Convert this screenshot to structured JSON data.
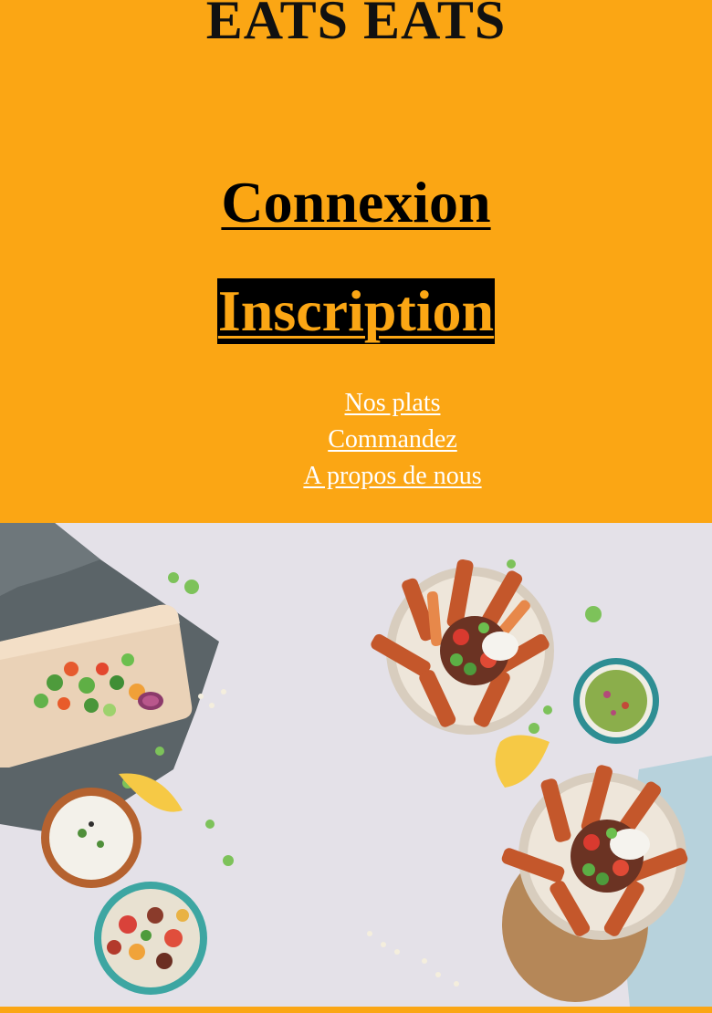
{
  "header": {
    "brand": "EATS EATS"
  },
  "auth": {
    "login_label": "Connexion",
    "signup_label": "Inscription"
  },
  "nav": {
    "items": [
      {
        "label": "Nos plats"
      },
      {
        "label": "Commandez"
      },
      {
        "label": "A propos de nous"
      }
    ]
  },
  "colors": {
    "background": "#FBA614",
    "brand_text": "#111111",
    "nav_text": "#FFFFFF",
    "signup_bg": "#000000"
  },
  "hero": {
    "image": "food-table-photo"
  }
}
